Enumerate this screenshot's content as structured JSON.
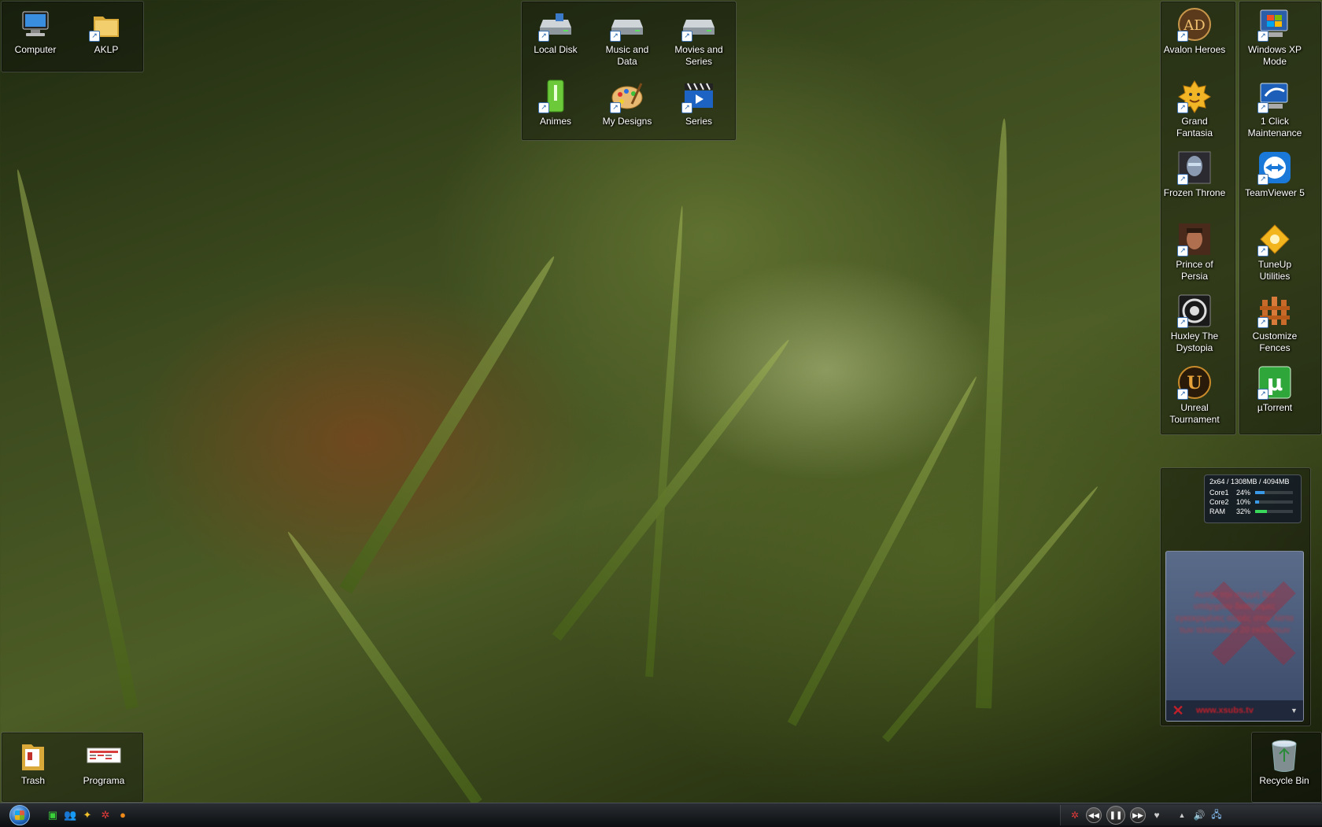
{
  "fences": {
    "top_left": [
      {
        "label": "Computer",
        "icon": "computer-icon"
      },
      {
        "label": "AKLP",
        "icon": "folder-icon"
      }
    ],
    "top_center": [
      {
        "label": "Local Disk",
        "icon": "drive-icon"
      },
      {
        "label": "Music and Data",
        "icon": "drive-icon"
      },
      {
        "label": "Movies and Series",
        "icon": "drive-icon"
      },
      {
        "label": "Animes",
        "icon": "green-usb-icon"
      },
      {
        "label": "My Designs",
        "icon": "palette-icon"
      },
      {
        "label": "Series",
        "icon": "clapperboard-icon"
      }
    ],
    "right_games": [
      {
        "label": "Avalon Heroes",
        "icon": "avalon-heroes-icon"
      },
      {
        "label": "Grand Fantasia",
        "icon": "grand-fantasia-icon"
      },
      {
        "label": "Frozen Throne",
        "icon": "frozen-throne-icon"
      },
      {
        "label": "Prince of Persia",
        "icon": "prince-of-persia-icon"
      },
      {
        "label": "Huxley The Dystopia",
        "icon": "huxley-icon"
      },
      {
        "label": "Unreal Tournament",
        "icon": "unreal-tournament-icon"
      }
    ],
    "right_apps": [
      {
        "label": "Windows XP Mode",
        "icon": "windows-xp-mode-icon"
      },
      {
        "label": "1 Click Maintenance",
        "icon": "maintenance-icon"
      },
      {
        "label": "TeamViewer 5",
        "icon": "teamviewer-icon"
      },
      {
        "label": "TuneUp Utilities",
        "icon": "tuneup-icon"
      },
      {
        "label": "Customize Fences",
        "icon": "fences-icon"
      },
      {
        "label": "µTorrent",
        "icon": "utorrent-icon"
      }
    ],
    "bottom_left": [
      {
        "label": "Trash",
        "icon": "folder-icon"
      },
      {
        "label": "Programa",
        "icon": "schedule-icon"
      }
    ],
    "bottom_right": [
      {
        "label": "Recycle Bin",
        "icon": "recycle-bin-icon"
      }
    ]
  },
  "sysmon": {
    "header": "2x64 / 1308MB / 4094MB",
    "rows": [
      {
        "name": "Core1",
        "value": "24%",
        "fraction": 0.24,
        "color": "#3a9ae8"
      },
      {
        "name": "Core2",
        "value": "10%",
        "fraction": 0.1,
        "color": "#3a9ae8"
      },
      {
        "name": "RAM",
        "value": "32%",
        "fraction": 0.32,
        "color": "#3ad85a"
      }
    ]
  },
  "subs_widget": {
    "message": "Αυτήν την στιγμή δεν υπάρχουν διαθέσιμες εγκεκριμένες σειρές στην λίστα των τελευταίων 20 εκδόσεων",
    "url": "www.xsubs.tv"
  },
  "taskbar": {
    "quick_launch": [
      "green-app-icon",
      "messenger-icon",
      "sunbird-icon",
      "red-gear-icon",
      "firefox-icon"
    ],
    "media_controls": [
      "rewind-icon",
      "pause-icon",
      "forward-icon",
      "heart-icon"
    ],
    "tray": [
      "expand-tray-icon",
      "volume-icon",
      "network-icon"
    ]
  }
}
